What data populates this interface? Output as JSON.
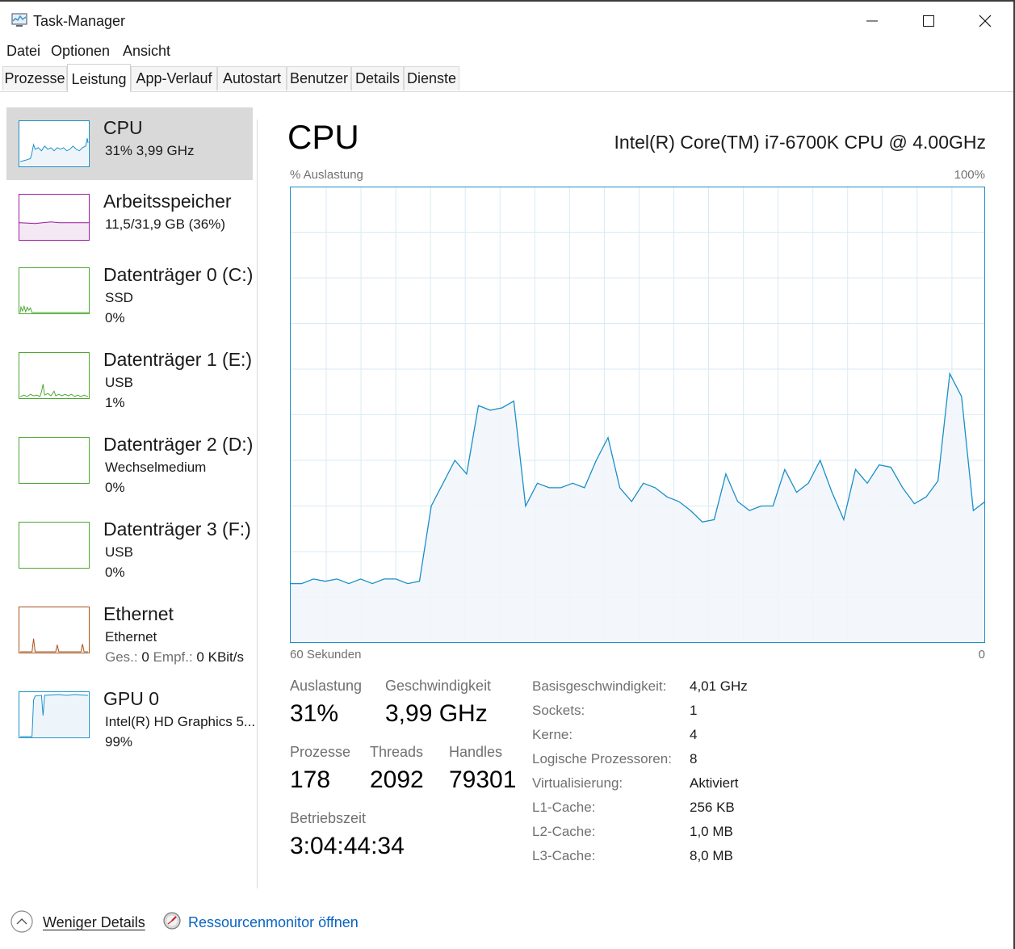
{
  "window": {
    "title": "Task-Manager",
    "controls": {
      "minimize": "minimize",
      "maximize": "maximize",
      "close": "close"
    }
  },
  "menu": [
    "Datei",
    "Optionen",
    "Ansicht"
  ],
  "tabs": [
    {
      "label": "Prozesse",
      "active": false
    },
    {
      "label": "Leistung",
      "active": true
    },
    {
      "label": "App-Verlauf",
      "active": false
    },
    {
      "label": "Autostart",
      "active": false
    },
    {
      "label": "Benutzer",
      "active": false
    },
    {
      "label": "Details",
      "active": false
    },
    {
      "label": "Dienste",
      "active": false
    }
  ],
  "sidebar": {
    "items": [
      {
        "title": "CPU",
        "line1": "31%  3,99 GHz",
        "selected": true,
        "color": "#1a8fc7"
      },
      {
        "title": "Arbeitsspeicher",
        "line1": "11,5/31,9 GB (36%)",
        "selected": false,
        "color": "#9c1ea0"
      },
      {
        "title": "Datenträger 0 (C:)",
        "line1": "SSD",
        "line2": "0%",
        "selected": false,
        "color": "#4ca630"
      },
      {
        "title": "Datenträger 1 (E:)",
        "line1": "USB",
        "line2": "1%",
        "selected": false,
        "color": "#4ca630"
      },
      {
        "title": "Datenträger 2 (D:)",
        "line1": "Wechselmedium",
        "line2": "0%",
        "selected": false,
        "color": "#4ca630"
      },
      {
        "title": "Datenträger 3 (F:)",
        "line1": "USB",
        "line2": "0%",
        "selected": false,
        "color": "#4ca630"
      },
      {
        "title": "Ethernet",
        "line1": "Ethernet",
        "line2_parts": {
          "send_label": "Ges.:",
          "send_value": "0",
          "recv_label": "Empf.:",
          "recv_value": "0 KBit/s"
        },
        "selected": false,
        "color": "#a9541f"
      },
      {
        "title": "GPU 0",
        "line1": "Intel(R) HD Graphics 5...",
        "line2": "99%",
        "selected": false,
        "color": "#1a8fc7"
      }
    ]
  },
  "main": {
    "title": "CPU",
    "model": "Intel(R) Core(TM) i7-6700K CPU @ 4.00GHz",
    "chart_top_left": "% Auslastung",
    "chart_top_right": "100%",
    "chart_bottom_left": "60 Sekunden",
    "chart_bottom_right": "0"
  },
  "chart_data": {
    "type": "area",
    "color": "#1a8fc7",
    "fill": "#f1f6fa",
    "ylim": [
      0,
      100
    ],
    "xlabel": "60 Sekunden",
    "ylabel": "% Auslastung",
    "grid": true,
    "y": [
      13,
      13,
      14,
      13.5,
      14,
      13,
      14,
      13,
      14,
      14,
      13,
      13.5,
      30,
      35,
      40,
      37,
      52,
      51,
      51.5,
      53,
      30,
      35,
      34,
      34,
      35,
      34,
      40,
      45,
      34,
      31,
      35,
      34,
      32,
      31,
      29,
      26.5,
      27,
      37,
      31,
      29,
      30,
      30,
      38,
      33,
      35,
      40,
      33,
      27,
      38,
      35,
      39,
      38.5,
      34,
      30.5,
      32,
      35.5,
      59,
      54,
      29,
      31
    ]
  },
  "stats": {
    "auslastung": {
      "label": "Auslastung",
      "value": "31%"
    },
    "geschwindigkeit": {
      "label": "Geschwindigkeit",
      "value": "3,99 GHz"
    },
    "prozesse": {
      "label": "Prozesse",
      "value": "178"
    },
    "threads": {
      "label": "Threads",
      "value": "2092"
    },
    "handles": {
      "label": "Handles",
      "value": "79301"
    },
    "betriebszeit": {
      "label": "Betriebszeit",
      "value": "3:04:44:34"
    }
  },
  "specs": [
    {
      "label": "Basisgeschwindigkeit:",
      "value": "4,01 GHz"
    },
    {
      "label": "Sockets:",
      "value": "1"
    },
    {
      "label": "Kerne:",
      "value": "4"
    },
    {
      "label": "Logische Prozessoren:",
      "value": "8"
    },
    {
      "label": "Virtualisierung:",
      "value": "Aktiviert"
    },
    {
      "label": "L1-Cache:",
      "value": "256 KB"
    },
    {
      "label": "L2-Cache:",
      "value": "1,0 MB"
    },
    {
      "label": "L3-Cache:",
      "value": "8,0 MB"
    }
  ],
  "footer": {
    "fewer_details": "Weniger Details",
    "resource_monitor": "Ressourcenmonitor öffnen"
  }
}
